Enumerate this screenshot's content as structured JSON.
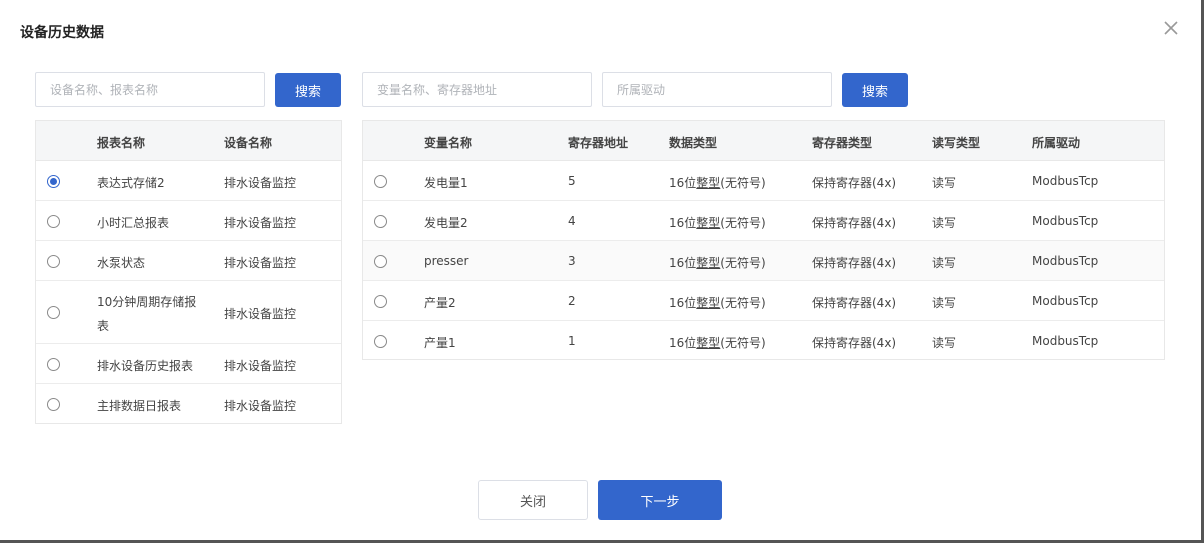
{
  "dialog": {
    "title": "设备历史数据"
  },
  "left_search": {
    "placeholder": "设备名称、报表名称",
    "button_label": "搜索"
  },
  "right_search": {
    "var_placeholder": "变量名称、寄存器地址",
    "driver_placeholder": "所属驱动",
    "button_label": "搜索"
  },
  "report_table": {
    "headers": [
      "报表名称",
      "设备名称"
    ],
    "rows": [
      {
        "report": "表达式存储2",
        "device": "排水设备监控",
        "selected": true
      },
      {
        "report": "小时汇总报表",
        "device": "排水设备监控",
        "selected": false
      },
      {
        "report": "水泵状态",
        "device": "排水设备监控",
        "selected": false
      },
      {
        "report_line1": "10分钟周期存储报",
        "report_line2": "表",
        "device": "排水设备监控",
        "selected": false
      },
      {
        "report": "排水设备历史报表",
        "device": "排水设备监控",
        "selected": false
      },
      {
        "report": "主排数据日报表",
        "device": "排水设备监控",
        "selected": false
      }
    ]
  },
  "variable_table": {
    "headers": [
      "变量名称",
      "寄存器地址",
      "数据类型",
      "寄存器类型",
      "读写类型",
      "所属驱动"
    ],
    "rows": [
      {
        "name": "发电量1",
        "address": "5",
        "data_type_prefix": "16位",
        "data_type_link": "整型",
        "data_type_suffix": "(无符号)",
        "register_type": "保持寄存器(4x)",
        "rw": "读写",
        "driver": "ModbusTcp"
      },
      {
        "name": "发电量2",
        "address": "4",
        "data_type_prefix": "16位",
        "data_type_link": "整型",
        "data_type_suffix": "(无符号)",
        "register_type": "保持寄存器(4x)",
        "rw": "读写",
        "driver": "ModbusTcp"
      },
      {
        "name": "presser",
        "address": "3",
        "data_type_prefix": "16位",
        "data_type_link": "整型",
        "data_type_suffix": "(无符号)",
        "register_type": "保持寄存器(4x)",
        "rw": "读写",
        "driver": "ModbusTcp"
      },
      {
        "name": "产量2",
        "address": "2",
        "data_type_prefix": "16位",
        "data_type_link": "整型",
        "data_type_suffix": "(无符号)",
        "register_type": "保持寄存器(4x)",
        "rw": "读写",
        "driver": "ModbusTcp"
      },
      {
        "name": "产量1",
        "address": "1",
        "data_type_prefix": "16位",
        "data_type_link": "整型",
        "data_type_suffix": "(无符号)",
        "register_type": "保持寄存器(4x)",
        "rw": "读写",
        "driver": "ModbusTcp"
      }
    ]
  },
  "footer": {
    "close_label": "关闭",
    "next_label": "下一步"
  },
  "icons": {
    "close": "close-icon"
  },
  "colors": {
    "primary": "#3366cc"
  }
}
